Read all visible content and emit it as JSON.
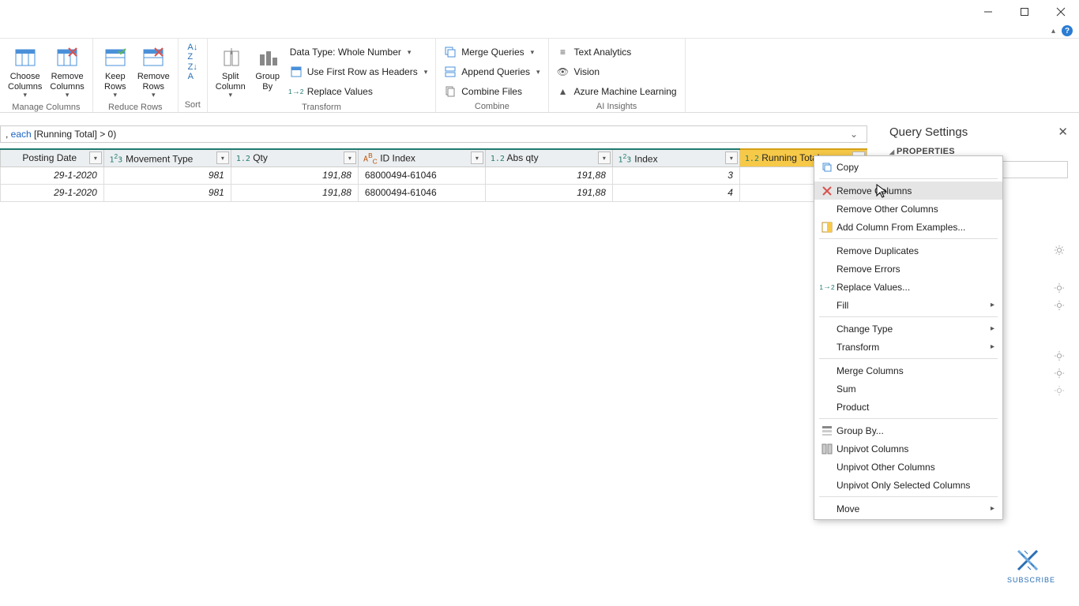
{
  "window": {
    "minimize": "—",
    "maximize": "☐",
    "close": "✕"
  },
  "ribbon": {
    "groups": {
      "manage_columns": {
        "label": "Manage Columns",
        "choose": "Choose\nColumns",
        "remove": "Remove\nColumns"
      },
      "reduce_rows": {
        "label": "Reduce Rows",
        "keep": "Keep\nRows",
        "remove": "Remove\nRows"
      },
      "sort": {
        "label": "Sort"
      },
      "transform": {
        "label": "Transform",
        "split": "Split\nColumn",
        "group": "Group\nBy",
        "datatype": "Data Type: Whole Number",
        "headers": "Use First Row as Headers",
        "replace": "Replace Values"
      },
      "combine": {
        "label": "Combine",
        "merge": "Merge Queries",
        "append": "Append Queries",
        "files": "Combine Files"
      },
      "ai": {
        "label": "AI Insights",
        "text": "Text Analytics",
        "vision": "Vision",
        "ml": "Azure Machine Learning"
      }
    }
  },
  "formula_bar": {
    "text": ", each [Running Total] > 0)"
  },
  "columns": [
    {
      "type": "date",
      "name": "Posting Date"
    },
    {
      "type": "int",
      "name": "Movement Type"
    },
    {
      "type": "dec",
      "name": "Qty"
    },
    {
      "type": "txt",
      "name": "ID Index"
    },
    {
      "type": "dec",
      "name": "Abs qty"
    },
    {
      "type": "int",
      "name": "Index"
    },
    {
      "type": "dec",
      "name": "Running Total",
      "selected": true
    }
  ],
  "rows": [
    {
      "posting": "29-1-2020",
      "movement": "981",
      "qty": "191,88",
      "idindex": "68000494-61046",
      "absqty": "191,88",
      "index": "3"
    },
    {
      "posting": "29-1-2020",
      "movement": "981",
      "qty": "191,88",
      "idindex": "68000494-61046",
      "absqty": "191,88",
      "index": "4"
    }
  ],
  "query_settings": {
    "title": "Query Settings",
    "properties": "PROPERTIES"
  },
  "context_menu": {
    "copy": "Copy",
    "remove_columns": "Remove Columns",
    "remove_other": "Remove Other Columns",
    "add_examples": "Add Column From Examples...",
    "remove_dup": "Remove Duplicates",
    "remove_err": "Remove Errors",
    "replace": "Replace Values...",
    "fill": "Fill",
    "change_type": "Change Type",
    "transform": "Transform",
    "merge": "Merge Columns",
    "sum": "Sum",
    "product": "Product",
    "group_by": "Group By...",
    "unpivot": "Unpivot Columns",
    "unpivot_other": "Unpivot Other Columns",
    "unpivot_sel": "Unpivot Only Selected Columns",
    "move": "Move"
  },
  "subscribe": "SUBSCRIBE"
}
